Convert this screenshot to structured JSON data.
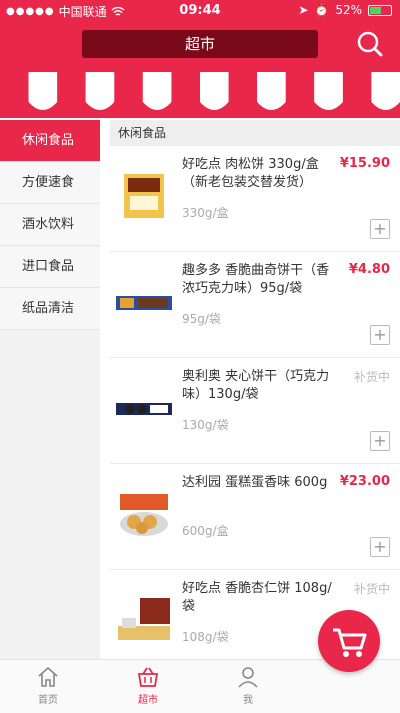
{
  "status_bar": {
    "carrier": "中国联通",
    "time": "09:44",
    "battery": "52%"
  },
  "header": {
    "title": "超市"
  },
  "sidebar": {
    "items": [
      {
        "label": "休闲食品",
        "active": true
      },
      {
        "label": "方便速食"
      },
      {
        "label": "酒水饮料"
      },
      {
        "label": "进口食品"
      },
      {
        "label": "纸品清洁"
      }
    ]
  },
  "main": {
    "section_title": "休闲食品",
    "products": [
      {
        "name": "好吃点 肉松饼 330g/盒（新老包装交替发货）",
        "spec": "330g/盒",
        "price": "¥15.90",
        "status": "",
        "add_label": "+"
      },
      {
        "name": "趣多多 香脆曲奇饼干（香浓巧克力味）95g/袋",
        "spec": "95g/袋",
        "price": "¥4.80",
        "status": "",
        "add_label": "+"
      },
      {
        "name": "奥利奥 夹心饼干（巧克力味）130g/袋",
        "spec": "130g/袋",
        "price": "",
        "status": "补货中",
        "add_label": "+"
      },
      {
        "name": "达利园 蛋糕蛋香味 600g",
        "spec": "600g/盒",
        "price": "¥23.00",
        "status": "",
        "add_label": "+"
      },
      {
        "name": "好吃点 香脆杏仁饼 108g/袋",
        "spec": "108g/袋",
        "price": "",
        "status": "补货中",
        "add_label": ""
      }
    ]
  },
  "tabbar": {
    "items": [
      {
        "label": "首页",
        "icon": "home-icon"
      },
      {
        "label": "超市",
        "icon": "basket-icon",
        "active": true
      },
      {
        "label": "我",
        "icon": "user-icon"
      }
    ]
  },
  "colors": {
    "brand": "#e8274a",
    "dark_bar": "#7a0a1a"
  }
}
